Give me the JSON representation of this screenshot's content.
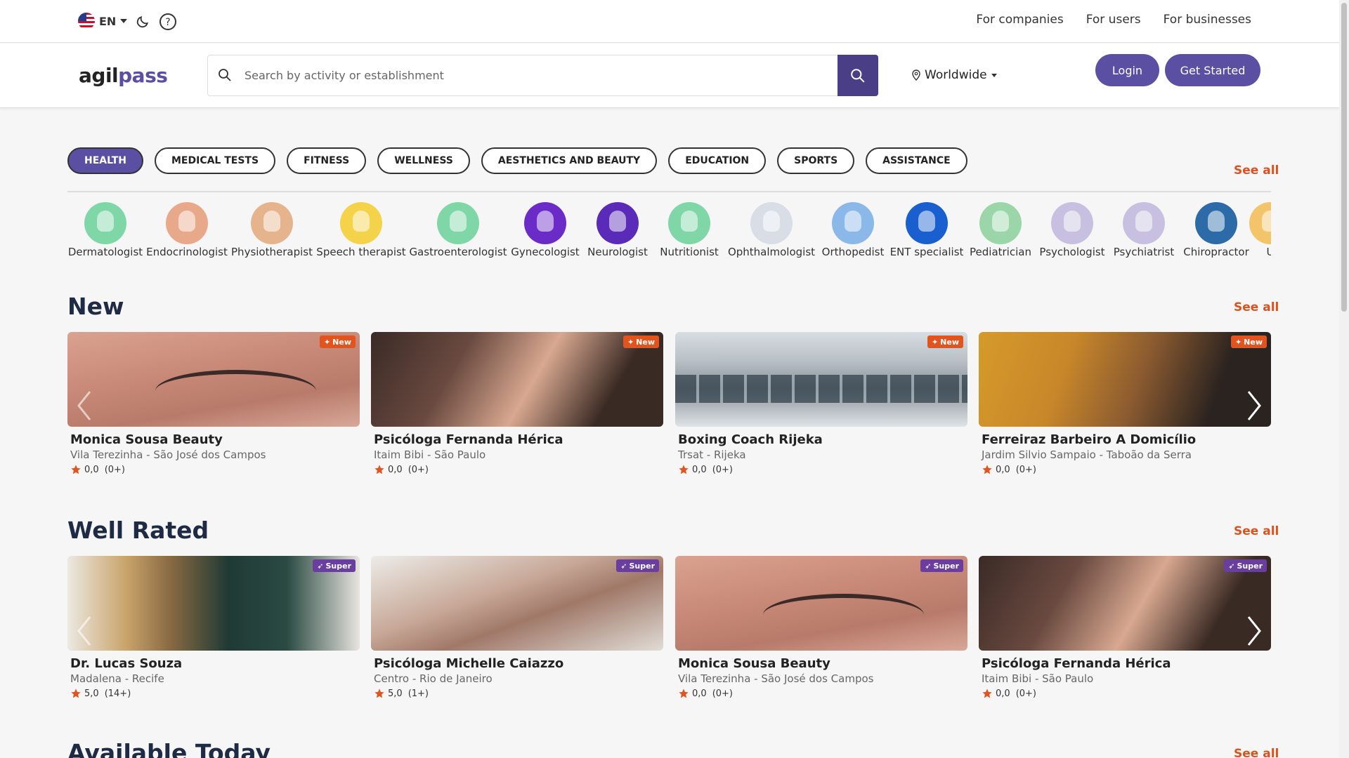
{
  "topbar": {
    "language": "EN",
    "links": [
      "For companies",
      "For users",
      "For businesses"
    ]
  },
  "header": {
    "logo_part1": "agil",
    "logo_part2": "pass",
    "search_placeholder": "Search by activity or establishment",
    "location": "Worldwide",
    "login": "Login",
    "get_started": "Get Started"
  },
  "categories": {
    "items": [
      "HEALTH",
      "MEDICAL TESTS",
      "FITNESS",
      "WELLNESS",
      "AESTHETICS AND BEAUTY",
      "EDUCATION",
      "SPORTS",
      "ASSISTANCE"
    ],
    "active": "HEALTH",
    "see_all": "See all"
  },
  "specialties": [
    {
      "label": "Dermatologist",
      "color": "#7fd6a6"
    },
    {
      "label": "Endocrinologist",
      "color": "#e8a88a"
    },
    {
      "label": "Physiotherapist",
      "color": "#e6b48c"
    },
    {
      "label": "Speech therapist",
      "color": "#f4d24a"
    },
    {
      "label": "Gastroenterologist",
      "color": "#7fd6a6"
    },
    {
      "label": "Gynecologist",
      "color": "#6b2bc8"
    },
    {
      "label": "Neurologist",
      "color": "#5a2ab8"
    },
    {
      "label": "Nutritionist",
      "color": "#7fd6a6"
    },
    {
      "label": "Ophthalmologist",
      "color": "#d8dde6"
    },
    {
      "label": "Orthopedist",
      "color": "#8ab8e8"
    },
    {
      "label": "ENT specialist",
      "color": "#1a5fd0"
    },
    {
      "label": "Pediatrician",
      "color": "#9ad6a8"
    },
    {
      "label": "Psychologist",
      "color": "#c8c0e0"
    },
    {
      "label": "Psychiatrist",
      "color": "#c8c0e0"
    },
    {
      "label": "Chiropractor",
      "color": "#2c6aa8"
    },
    {
      "label": "U",
      "color": "#f4c46a"
    }
  ],
  "new_section": {
    "title": "New",
    "see_all": "See all",
    "badge": "New",
    "cards": [
      {
        "name": "Monica Sousa Beauty",
        "place": "Vila Terezinha - São José dos Campos",
        "score": "0,0",
        "count": "(0+)",
        "image": "lash"
      },
      {
        "name": "Psicóloga Fernanda Hérica",
        "place": "Itaim Bibi - São Paulo",
        "score": "0,0",
        "count": "(0+)",
        "image": "woman"
      },
      {
        "name": "Boxing Coach Rijeka",
        "place": "Trsat - Rijeka",
        "score": "0,0",
        "count": "(0+)",
        "image": "building"
      },
      {
        "name": "Ferreiraz Barbeiro A Domicílio",
        "place": "Jardim Silvio Sampaio - Taboão da Serra",
        "score": "0,0",
        "count": "(0+)",
        "image": "barber"
      }
    ]
  },
  "well_rated": {
    "title": "Well Rated",
    "see_all": "See all",
    "badge": "Super",
    "cards": [
      {
        "name": "Dr. Lucas Souza",
        "place": "Madalena - Recife",
        "score": "5,0",
        "count": "(14+)",
        "image": "room"
      },
      {
        "name": "Psicóloga Michelle Caiazzo",
        "place": "Centro - Rio de Janeiro",
        "score": "5,0",
        "count": "(1+)",
        "image": "woman2"
      },
      {
        "name": "Monica Sousa Beauty",
        "place": "Vila Terezinha - São José dos Campos",
        "score": "0,0",
        "count": "(0+)",
        "image": "lash"
      },
      {
        "name": "Psicóloga Fernanda Hérica",
        "place": "Itaim Bibi - São Paulo",
        "score": "0,0",
        "count": "(0+)",
        "image": "woman"
      }
    ]
  },
  "available_today": {
    "title": "Available Today",
    "see_all": "See all"
  },
  "colors": {
    "brand": "#5b4fa3",
    "accent": "#d9531e",
    "new_badge": "#e2541d",
    "super_badge": "#6a3ea1",
    "star": "#e2541d"
  }
}
